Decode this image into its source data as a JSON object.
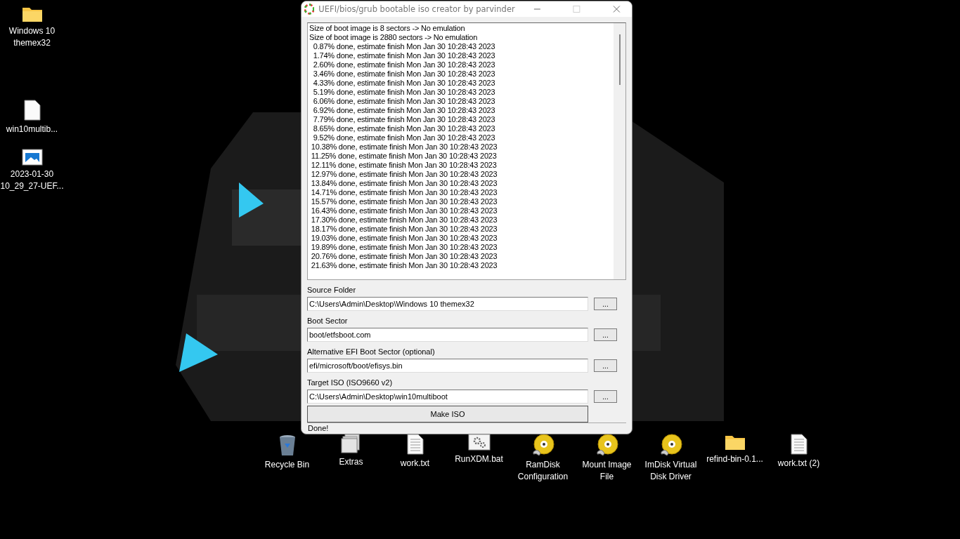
{
  "left_icons": [
    {
      "label": "Windows 10\nthemex32",
      "kind": "folder"
    },
    {
      "label": "win10multib...",
      "kind": "file"
    },
    {
      "label": "2023-01-30\n10_29_27-UEF...",
      "kind": "image"
    }
  ],
  "bottom_icons": [
    {
      "label": "Recycle Bin",
      "kind": "recycle"
    },
    {
      "label": "Extras",
      "kind": "folders"
    },
    {
      "label": "work.txt",
      "kind": "text"
    },
    {
      "label": "RunXDM.bat",
      "kind": "batch"
    },
    {
      "label": "RamDisk\nConfiguration",
      "kind": "disc"
    },
    {
      "label": "Mount Image\nFile",
      "kind": "disc"
    },
    {
      "label": "ImDisk Virtual\nDisk Driver",
      "kind": "disc"
    },
    {
      "label": "refind-bin-0.1...",
      "kind": "folder"
    },
    {
      "label": "work.txt (2)",
      "kind": "text"
    }
  ],
  "window": {
    "title": "UEFI/bios/grub bootable iso creator by parvinder",
    "log": [
      "Size of boot image is 8 sectors -> No emulation",
      "Size of boot image is 2880 sectors -> No emulation",
      "  0.87% done, estimate finish Mon Jan 30 10:28:43 2023",
      "  1.74% done, estimate finish Mon Jan 30 10:28:43 2023",
      "  2.60% done, estimate finish Mon Jan 30 10:28:43 2023",
      "  3.46% done, estimate finish Mon Jan 30 10:28:43 2023",
      "  4.33% done, estimate finish Mon Jan 30 10:28:43 2023",
      "  5.19% done, estimate finish Mon Jan 30 10:28:43 2023",
      "  6.06% done, estimate finish Mon Jan 30 10:28:43 2023",
      "  6.92% done, estimate finish Mon Jan 30 10:28:43 2023",
      "  7.79% done, estimate finish Mon Jan 30 10:28:43 2023",
      "  8.65% done, estimate finish Mon Jan 30 10:28:43 2023",
      "  9.52% done, estimate finish Mon Jan 30 10:28:43 2023",
      " 10.38% done, estimate finish Mon Jan 30 10:28:43 2023",
      " 11.25% done, estimate finish Mon Jan 30 10:28:43 2023",
      " 12.11% done, estimate finish Mon Jan 30 10:28:43 2023",
      " 12.97% done, estimate finish Mon Jan 30 10:28:43 2023",
      " 13.84% done, estimate finish Mon Jan 30 10:28:43 2023",
      " 14.71% done, estimate finish Mon Jan 30 10:28:43 2023",
      " 15.57% done, estimate finish Mon Jan 30 10:28:43 2023",
      " 16.43% done, estimate finish Mon Jan 30 10:28:43 2023",
      " 17.30% done, estimate finish Mon Jan 30 10:28:43 2023",
      " 18.17% done, estimate finish Mon Jan 30 10:28:43 2023",
      " 19.03% done, estimate finish Mon Jan 30 10:28:43 2023",
      " 19.89% done, estimate finish Mon Jan 30 10:28:43 2023",
      " 20.76% done, estimate finish Mon Jan 30 10:28:43 2023",
      " 21.63% done, estimate finish Mon Jan 30 10:28:43 2023"
    ],
    "fields": [
      {
        "label": "Source Folder",
        "value": "C:\\Users\\Admin\\Desktop\\Windows 10 themex32",
        "button": "..."
      },
      {
        "label": "Boot Sector",
        "value": "boot/etfsboot.com",
        "button": "..."
      },
      {
        "label": "Alternative EFI Boot Sector (optional)",
        "value": "efi/microsoft/boot/efisys.bin",
        "button": "..."
      },
      {
        "label": "Target ISO (ISO9660 v2)",
        "value": "C:\\Users\\Admin\\Desktop\\win10multiboot",
        "button": "..."
      }
    ],
    "make_button": "Make ISO",
    "status_bar": "Done!"
  }
}
